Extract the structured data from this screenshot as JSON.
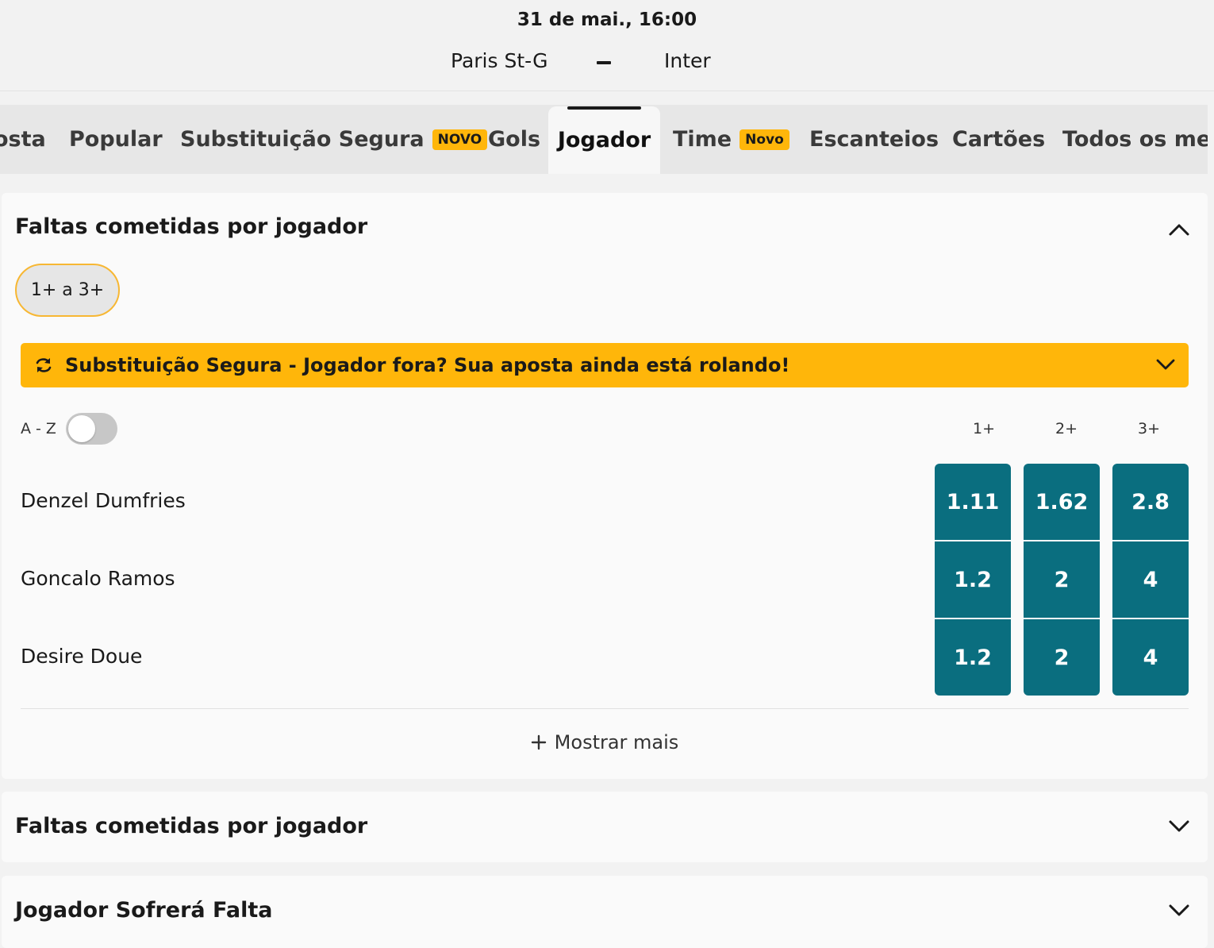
{
  "match": {
    "datetime": "31 de mai., 16:00",
    "home_team": "Paris St-G",
    "away_team": "Inter"
  },
  "tabs": [
    {
      "label": "osta",
      "active": false
    },
    {
      "label": "Popular",
      "active": false
    },
    {
      "label": "Substituição Segura",
      "badge": "NOVO",
      "active": false
    },
    {
      "label": "Gols",
      "active": false
    },
    {
      "label": "Jogador",
      "active": true
    },
    {
      "label": "Time",
      "badge": "Novo",
      "active": false
    },
    {
      "label": "Escanteios",
      "active": false
    },
    {
      "label": "Cartões",
      "active": false
    },
    {
      "label": "Todos os mer",
      "active": false
    }
  ],
  "market": {
    "title": "Faltas cometidas por jogador",
    "range_pill": "1+ a 3+",
    "banner": {
      "icon": "swap-arrows-icon",
      "text": "Substituição Segura - Jogador fora? Sua aposta ainda está rolando!"
    },
    "sort_label": "A - Z",
    "sort_toggle_on": false,
    "columns": [
      "1+",
      "2+",
      "3+"
    ],
    "rows": [
      {
        "player": "Denzel Dumfries",
        "odds": [
          "1.11",
          "1.62",
          "2.8"
        ]
      },
      {
        "player": "Goncalo Ramos",
        "odds": [
          "1.2",
          "2",
          "4"
        ]
      },
      {
        "player": "Desire Doue",
        "odds": [
          "1.2",
          "2",
          "4"
        ]
      }
    ],
    "show_more": "Mostrar mais"
  },
  "collapsed_markets": [
    {
      "title": "Faltas cometidas por jogador"
    },
    {
      "title": "Jogador Sofrerá Falta"
    }
  ],
  "colors": {
    "accent": "#ffb60a",
    "odds_button": "#0a6e7f",
    "background": "#f2f2f2",
    "card": "#fafafa"
  }
}
